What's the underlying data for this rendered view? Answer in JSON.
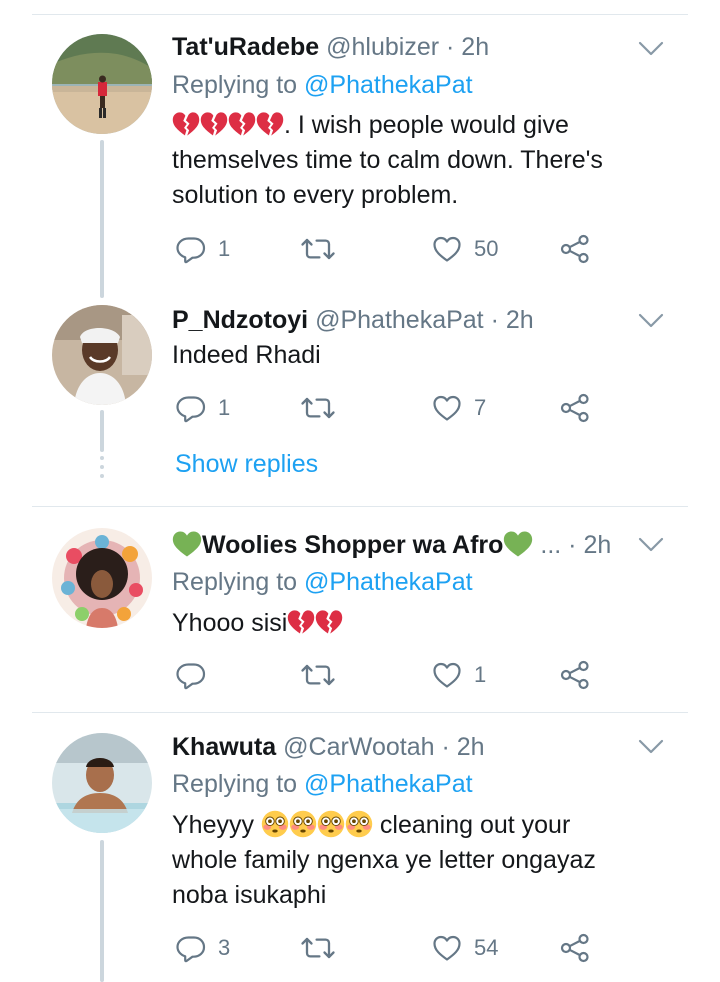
{
  "tweets": [
    {
      "name": "Tat'uRadebe",
      "handle": "@hlubizer",
      "sep": "·",
      "time": "2h",
      "reply_prefix": "Replying to",
      "reply_mention": "@PhathekaPat",
      "text_lines": [
        ". I wish people would give",
        "themselves time to calm down. There's",
        "solution to every problem."
      ],
      "emoji": "broken-heart x4",
      "reply_count": "1",
      "retweet_count": "",
      "like_count": "50"
    },
    {
      "name": "P_Ndzotoyi",
      "handle": "@PhathekaPat",
      "sep": "·",
      "time": "2h",
      "text_lines": [
        "Indeed Rhadi"
      ],
      "reply_count": "1",
      "retweet_count": "",
      "like_count": "7",
      "show_replies": "Show replies"
    },
    {
      "name": "Woolies Shopper wa Afro",
      "name_emoji": "green-heart",
      "handle_truncated": "...",
      "sep": "·",
      "time": "2h",
      "reply_prefix": "Replying to",
      "reply_mention": "@PhathekaPat",
      "text_lines": [
        "Yhooo sisi"
      ],
      "emoji": "broken-heart x2",
      "reply_count": "",
      "retweet_count": "",
      "like_count": "1"
    },
    {
      "name": "Khawuta",
      "handle": "@CarWootah",
      "sep": "·",
      "time": "2h",
      "reply_prefix": "Replying to",
      "reply_mention": "@PhathekaPat",
      "text_lines": [
        "Yheyyy",
        " cleaning out your",
        "whole family ngenxa ye letter ongayaz",
        "noba isukaphi"
      ],
      "emoji": "flushed-face x4",
      "reply_count": "3",
      "retweet_count": "",
      "like_count": "54"
    }
  ],
  "colors": {
    "text": "#14171a",
    "secondary": "#657786",
    "link": "#1da1f2",
    "divider": "#e1e8ed",
    "thread_line": "#ccd6dd"
  },
  "icons": [
    "reply-icon",
    "retweet-icon",
    "like-icon",
    "share-icon",
    "chevron-down-icon",
    "broken-heart-icon",
    "green-heart-icon",
    "flushed-face-icon"
  ]
}
